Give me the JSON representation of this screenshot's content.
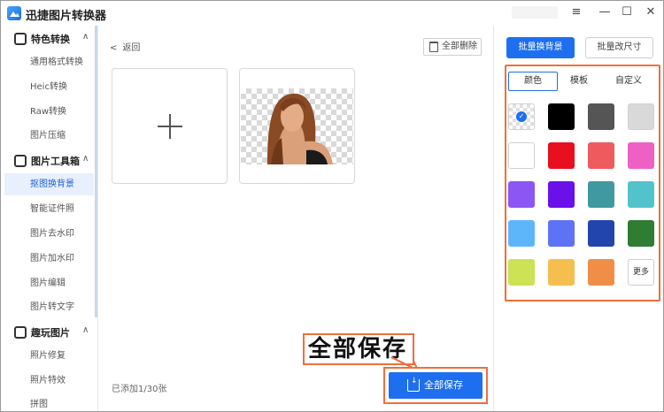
{
  "window": {
    "title": "迅捷图片转换器",
    "minimize_icon": "—",
    "maximize_icon": "☐",
    "menu_icon": "≡",
    "close_icon": "✕"
  },
  "sidebar": {
    "sections": [
      {
        "label": "特色转换",
        "icon": "swap-icon",
        "chevron": "∧",
        "items": [
          "通用格式转换",
          "Heic转换",
          "Raw转换",
          "图片压缩"
        ]
      },
      {
        "label": "图片工具箱",
        "icon": "toolbox-icon",
        "chevron": "∧",
        "items": [
          "抠图换背景",
          "智能证件照",
          "图片去水印",
          "图片加水印",
          "图片编辑",
          "图片转文字"
        ]
      },
      {
        "label": "趣玩图片",
        "icon": "image-icon",
        "chevron": "∧",
        "items": [
          "照片修复",
          "照片特效",
          "拼图"
        ]
      }
    ],
    "active_item": "抠图换背景"
  },
  "main": {
    "back_label": "返回",
    "back_chevron": "<",
    "delete_all_label": "全部删除",
    "count_label": "已添加1/30张",
    "save_all_label": "全部保存",
    "callout_text": "全部保存"
  },
  "right_panel": {
    "mode_tabs": [
      "批量换背景",
      "批量改尺寸"
    ],
    "active_mode": "批量换背景",
    "palette_tabs": [
      "颜色",
      "模板",
      "自定义"
    ],
    "active_palette_tab": "颜色",
    "checkmark": "✓",
    "more_label": "更多",
    "colors": [
      "transparent",
      "#000000",
      "#555555",
      "#d9d9d9",
      "#ffffff",
      "#e8101e",
      "#ee5a5e",
      "#ee60c4",
      "#8c56f5",
      "#6a10e8",
      "#3e9aa0",
      "#52c3cb",
      "#5eb6fa",
      "#5e72f5",
      "#2245ad",
      "#2e7d33",
      "#cde254",
      "#f5bf50",
      "#f08e48",
      "more"
    ],
    "selected_color": "transparent"
  },
  "accent": {
    "primary": "#1e6ff0",
    "highlight": "#ef6f3c"
  }
}
